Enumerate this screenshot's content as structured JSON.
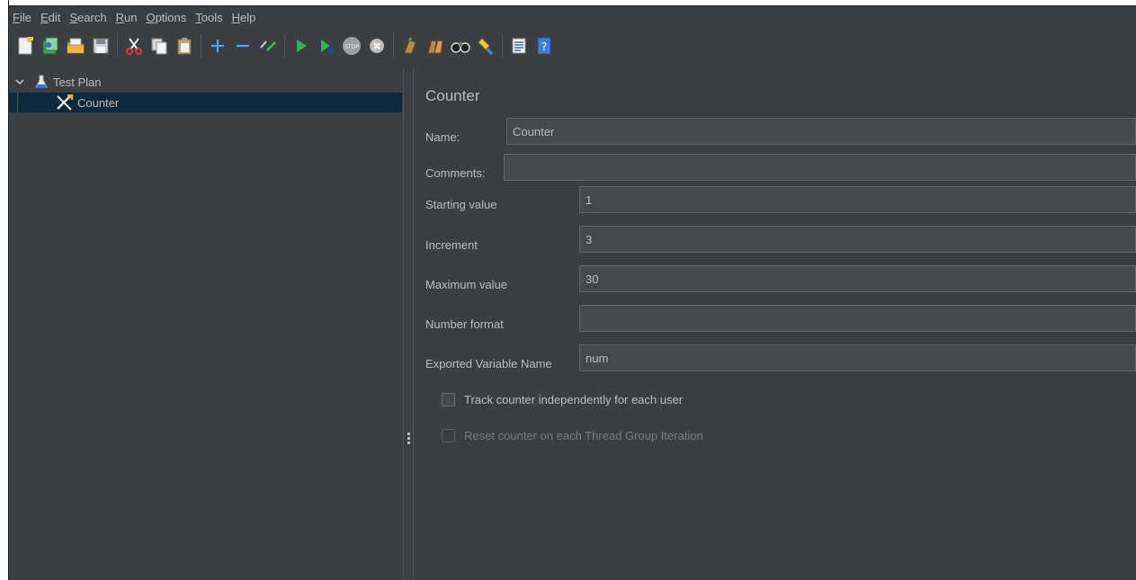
{
  "menu": [
    {
      "label": "File",
      "mn": "F",
      "rest": "ile"
    },
    {
      "label": "Edit",
      "mn": "E",
      "rest": "dit"
    },
    {
      "label": "Search",
      "mn": "S",
      "rest": "earch"
    },
    {
      "label": "Run",
      "mn": "R",
      "rest": "un"
    },
    {
      "label": "Options",
      "mn": "O",
      "rest": "ptions"
    },
    {
      "label": "Tools",
      "mn": "T",
      "rest": "ools"
    },
    {
      "label": "Help",
      "mn": "H",
      "rest": "elp"
    }
  ],
  "toolbar": {
    "icons": [
      "new-icon",
      "templates-icon",
      "open-icon",
      "save-icon",
      "cut-icon",
      "copy-icon",
      "paste-icon",
      "expand-icon",
      "collapse-icon",
      "toggle-icon",
      "start-icon",
      "start-no-pauses-icon",
      "stop-icon",
      "shutdown-icon",
      "clear-icon",
      "clear-all-icon",
      "search-icon",
      "reset-search-icon",
      "function-helper-icon",
      "help-icon"
    ]
  },
  "tree": {
    "root_label": "Test Plan",
    "child_label": "Counter"
  },
  "editor": {
    "title": "Counter",
    "name_label": "Name:",
    "name_value": "Counter",
    "comments_label": "Comments:",
    "comments_value": "",
    "starting_label": "Starting value",
    "starting_value": "1",
    "increment_label": "Increment",
    "increment_value": "3",
    "maximum_label": "Maximum value",
    "maximum_value": "30",
    "format_label": "Number format",
    "format_value": "",
    "exported_label": "Exported Variable Name",
    "exported_value": "num",
    "track_label": "Track counter independently for each user",
    "reset_label": "Reset counter on each Thread Group Iteration"
  },
  "colors": {
    "background": "#3c3f41",
    "selection": "#0d293e",
    "field": "#45494a",
    "text": "#bbbbbb",
    "run_green": "#4caf50"
  }
}
